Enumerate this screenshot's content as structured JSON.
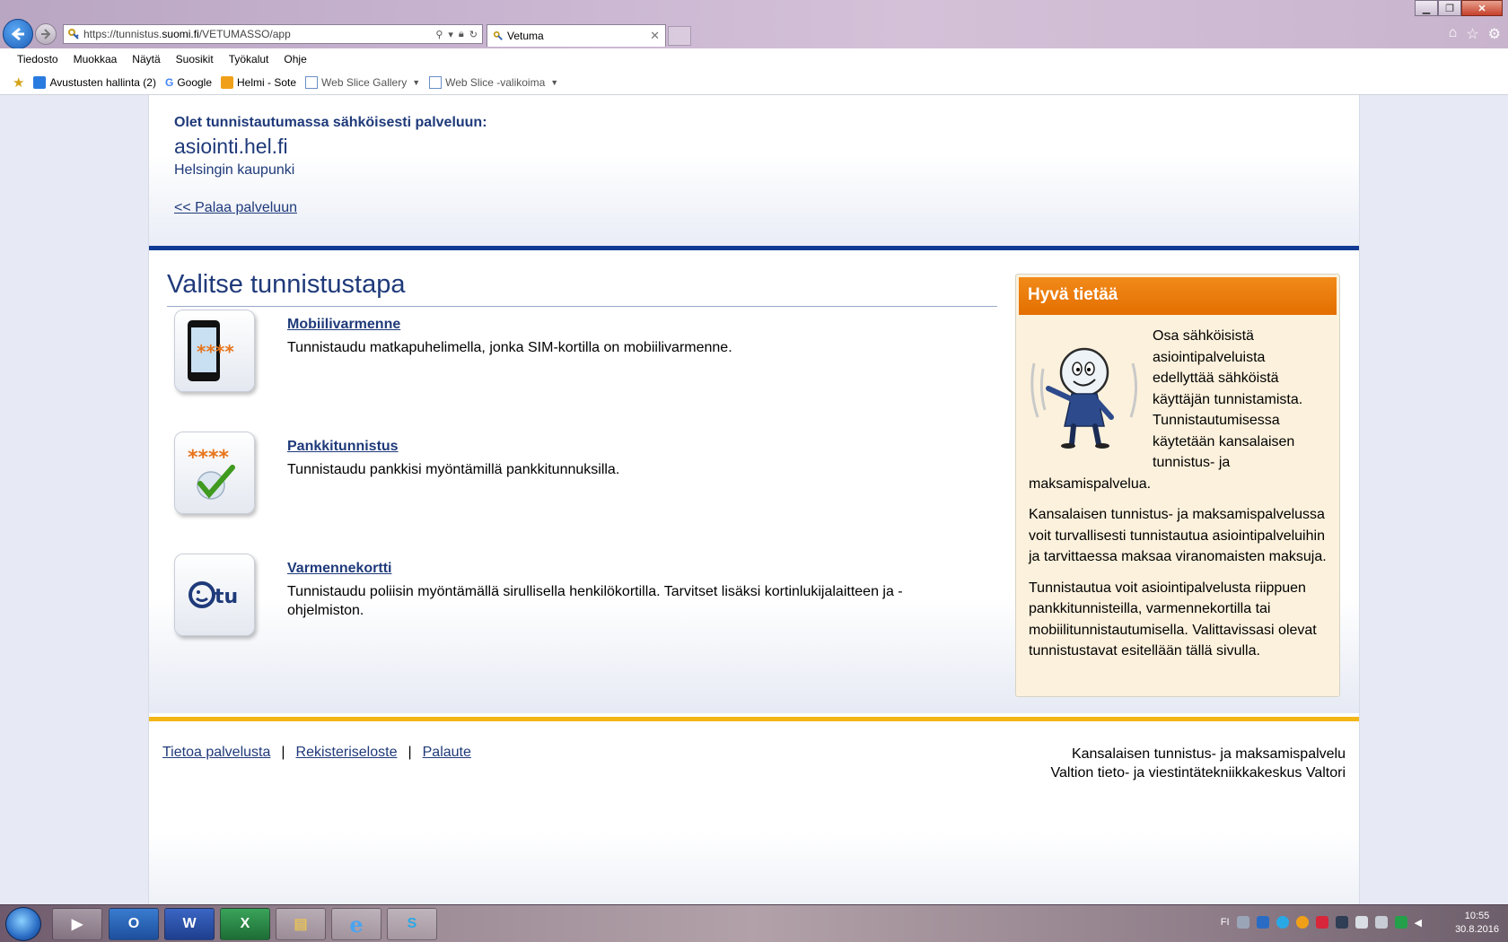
{
  "browser": {
    "url_prefix": "https://tunnistus.",
    "url_domain": "suomi.fi",
    "url_path": "/VETUMASSO/app",
    "tab_title": "Vetuma",
    "menu": [
      "Tiedosto",
      "Muokkaa",
      "Näytä",
      "Suosikit",
      "Työkalut",
      "Ohje"
    ],
    "favorites": [
      {
        "label": "Avustusten hallinta (2)",
        "icon": "ie-page-icon"
      },
      {
        "label": "Google",
        "icon": "google-icon"
      },
      {
        "label": "Helmi - Sote",
        "icon": "helmi-icon"
      },
      {
        "label": "Web Slice Gallery",
        "icon": "web-slice-icon"
      },
      {
        "label": "Web Slice -valikoima",
        "icon": "web-slice-icon"
      }
    ]
  },
  "header": {
    "intro": "Olet tunnistautumassa sähköisesti palveluun:",
    "service": "asiointi.hel.fi",
    "organization": "Helsingin kaupunki",
    "back_link": "<< Palaa palveluun"
  },
  "main": {
    "heading": "Valitse tunnistustapa",
    "methods": [
      {
        "title": "Mobiilivarmenne",
        "description": "Tunnistaudu matkapuhelimella, jonka SIM-kortilla on mobiilivarmenne.",
        "icon": "mobile-phone-icon",
        "icon_text": "****"
      },
      {
        "title": "Pankkitunnistus",
        "description": "Tunnistaudu pankkisi myöntämillä pankkitunnuksilla.",
        "icon": "bank-checkmark-icon",
        "icon_text": "****"
      },
      {
        "title": "Varmennekortti",
        "description": "Tunnistaudu poliisin myöntämällä sirullisella henkilökortilla. Tarvitset lisäksi kortinlukijalaitteen ja -ohjelmiston.",
        "icon": "etu-card-icon",
        "icon_text": "tu"
      }
    ]
  },
  "infobox": {
    "title": "Hyvä tietää",
    "paragraphs": [
      "Osa sähköisistä asiointipalveluista edellyttää sähköistä käyttäjän tunnistamista. Tunnistautumisessa käytetään kansalaisen tunnistus- ja maksamispalvelua.",
      "Kansalaisen tunnistus- ja maksamispalvelussa voit turvallisesti tunnistautua asiointipalveluihin ja tarvittaessa maksaa viranomaisten maksuja.",
      "Tunnistautua voit asiointipalvelusta riippuen pankkitunnisteilla, varmennekortilla tai mobiilitunnistautumisella. Valittavissasi olevat tunnistustavat esitellään tällä sivulla."
    ]
  },
  "footer": {
    "links": [
      "Tietoa palvelusta",
      "Rekisteriseloste",
      "Palaute"
    ],
    "separator": "|",
    "right_line1": "Kansalaisen tunnistus- ja maksamispalvelu",
    "right_line2": "Valtion tieto- ja viestintätekniikkakeskus Valtori"
  },
  "taskbar": {
    "apps": [
      {
        "name": "media-player-icon",
        "glyph": "▶"
      },
      {
        "name": "outlook-icon",
        "glyph": "O"
      },
      {
        "name": "word-icon",
        "glyph": "W"
      },
      {
        "name": "excel-icon",
        "glyph": "X"
      },
      {
        "name": "file-explorer-icon",
        "glyph": "▤"
      },
      {
        "name": "internet-explorer-icon",
        "glyph": "e"
      },
      {
        "name": "skype-icon",
        "glyph": "S"
      }
    ],
    "language": "FI",
    "time": "10:55",
    "date": "30.8.2016"
  },
  "colors": {
    "accent_blue": "#1f3a7a",
    "orange": "#e36f00",
    "yellow_bar": "#f2b615",
    "dark_blue_bar": "#0f3a93"
  }
}
